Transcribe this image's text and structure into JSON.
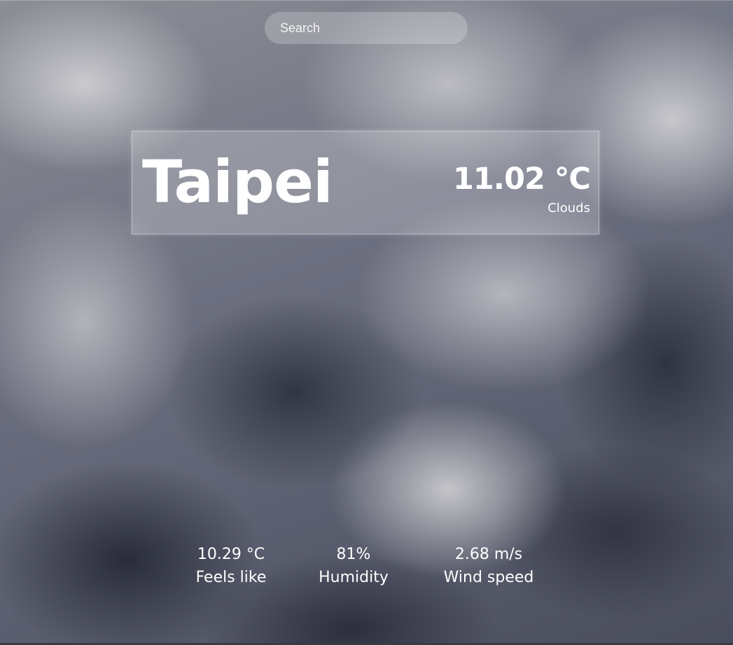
{
  "search": {
    "placeholder": "Search",
    "value": ""
  },
  "current": {
    "city": "Taipei",
    "temperature": "11.02 °C",
    "condition": "Clouds"
  },
  "details": {
    "feels_like": {
      "value": "10.29 °C",
      "label": "Feels like"
    },
    "humidity": {
      "value": "81%",
      "label": "Humidity"
    },
    "wind": {
      "value": "2.68 m/s",
      "label": "Wind speed"
    }
  },
  "background": {
    "description_color_light": "#d2d2d6",
    "description_color_dark": "#2a2d3a"
  }
}
